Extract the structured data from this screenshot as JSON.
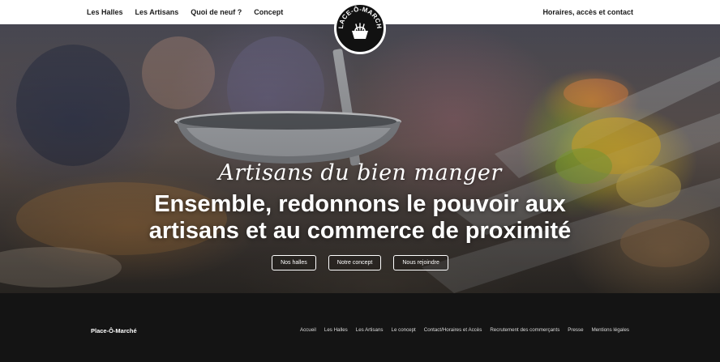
{
  "header": {
    "nav": [
      {
        "label": "Les Halles"
      },
      {
        "label": "Les Artisans"
      },
      {
        "label": "Quoi de neuf ?"
      },
      {
        "label": "Concept"
      }
    ],
    "right_link": "Horaires, accès et contact",
    "logo_text": "PLACE-Ô-MARCHÉ"
  },
  "hero": {
    "tagline": "Artisans du bien manger",
    "headline_line1": "Ensemble, redonnons le pouvoir aux",
    "headline_line2": "artisans et au commerce de proximité",
    "buttons": [
      {
        "label": "Nos halles"
      },
      {
        "label": "Notre concept"
      },
      {
        "label": "Nous rejoindre"
      }
    ]
  },
  "footer": {
    "brand": "Place-Ô-Marché",
    "links": [
      {
        "label": "Accueil"
      },
      {
        "label": "Les Halles"
      },
      {
        "label": "Les Artisans"
      },
      {
        "label": "Le concept"
      },
      {
        "label": "Contact/Horaires et Accès"
      },
      {
        "label": "Recrutement des commerçants"
      },
      {
        "label": "Presse"
      },
      {
        "label": "Mentions légales"
      }
    ]
  },
  "colors": {
    "header_bg": "#ffffff",
    "footer_bg": "#141414",
    "text_dark": "#1b1b1b",
    "text_light": "#ffffff"
  }
}
